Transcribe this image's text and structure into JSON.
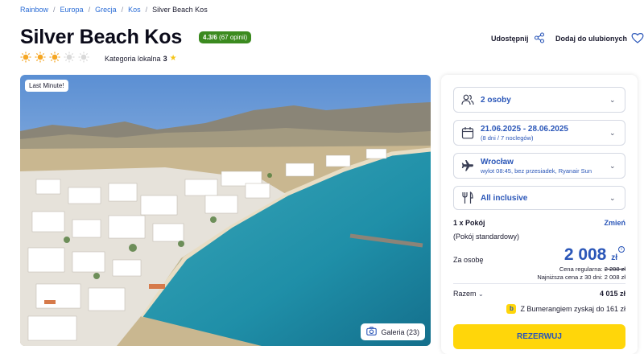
{
  "breadcrumb": [
    "Rainbow",
    "Europa",
    "Grecja",
    "Kos",
    "Silver Beach Kos"
  ],
  "hotel": {
    "name": "Silver Beach Kos",
    "rating_score": "4.3/6",
    "rating_count": "(67 opinii)",
    "suns_filled": 3,
    "suns_total": 5,
    "category_label": "Kategoria lokalna",
    "category_value": "3"
  },
  "actions": {
    "share_label": "Udostępnij",
    "favorite_label": "Dodaj do ulubionych"
  },
  "gallery": {
    "badge": "Last Minute!",
    "button_label": "Galeria (23)"
  },
  "booking": {
    "persons": "2 osoby",
    "dates": "21.06.2025 - 28.06.2025",
    "dates_sub": "(8 dni / 7 noclegów)",
    "departure": "Wrocław",
    "departure_sub": "wylot 08:45, bez przesiadek, Ryanair Sun",
    "board": "All inclusive",
    "room_label": "1 x Pokój",
    "change_label": "Zmień",
    "room_type": "(Pokój standardowy)",
    "per_person_label": "Za osobę",
    "price_value": "2 008",
    "price_currency": "zł",
    "regular_label": "Cena regularna:",
    "regular_price": "2 208 zł",
    "lowest_label": "Najniższa cena z 30 dni: 2 008 zł",
    "total_label": "Razem",
    "total_value": "4 015 zł",
    "bumerang_text": "Z Bumerangiem zyskaj do 161 zł",
    "book_label": "REZERWUJ"
  },
  "colors": {
    "accent_blue": "#2a56b8",
    "link_blue": "#2a6cd6",
    "cta_yellow": "#ffd60a",
    "rating_green": "#3b8a1f",
    "sun_filled": "#f5a623",
    "sun_empty": "#d9d9d9"
  },
  "icons": {
    "persons": "persons-icon",
    "calendar": "calendar-icon",
    "plane": "plane-icon",
    "board": "cutlery-icon",
    "share": "share-icon",
    "favorite": "heart-icon",
    "gallery": "camera-icon"
  }
}
